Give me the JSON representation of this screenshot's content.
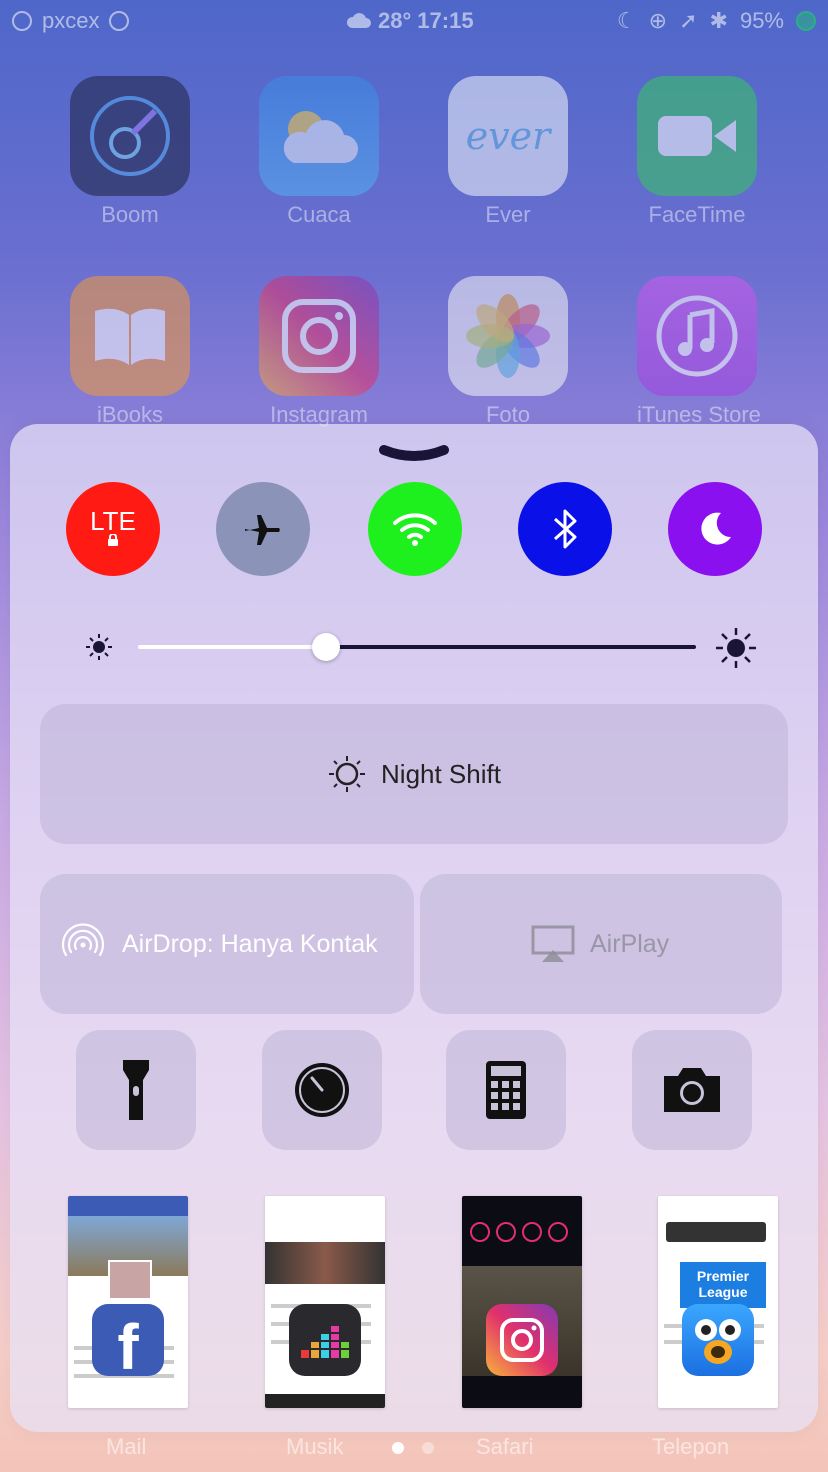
{
  "status": {
    "carrier": "pxcex",
    "temperature": "28°",
    "time": "17:15",
    "battery": "95%"
  },
  "home_apps": [
    "Boom",
    "Cuaca",
    "Ever",
    "FaceTime",
    "iBooks",
    "Instagram",
    "Foto",
    "iTunes Store"
  ],
  "ever_logo": "ever",
  "dock": [
    "Mail",
    "Musik",
    "Safari",
    "Telepon"
  ],
  "control_center": {
    "toggles": [
      {
        "name": "cellular-lte",
        "label": "LTE",
        "color": "#ff1a14"
      },
      {
        "name": "airplane-mode",
        "color": "#8b93b8"
      },
      {
        "name": "wifi",
        "color": "#1ef01e"
      },
      {
        "name": "bluetooth",
        "color": "#0a10e8"
      },
      {
        "name": "do-not-disturb",
        "color": "#8a10f0"
      }
    ],
    "brightness_level": 0.34,
    "night_shift_label": "Night Shift",
    "airdrop_label": "AirDrop: Hanya Kontak",
    "airplay_label": "AirPlay",
    "tools": [
      "flashlight-icon",
      "timer-icon",
      "calculator-icon",
      "camera-icon"
    ],
    "recent_apps": [
      {
        "name": "facebook",
        "color": "#3b5bb5"
      },
      {
        "name": "deezer",
        "color": "#2a2a2e"
      },
      {
        "name": "instagram",
        "color": "#d62976"
      },
      {
        "name": "tweetbot",
        "color": "#2a86e8"
      }
    ],
    "premier_league_text": "Premier League"
  }
}
